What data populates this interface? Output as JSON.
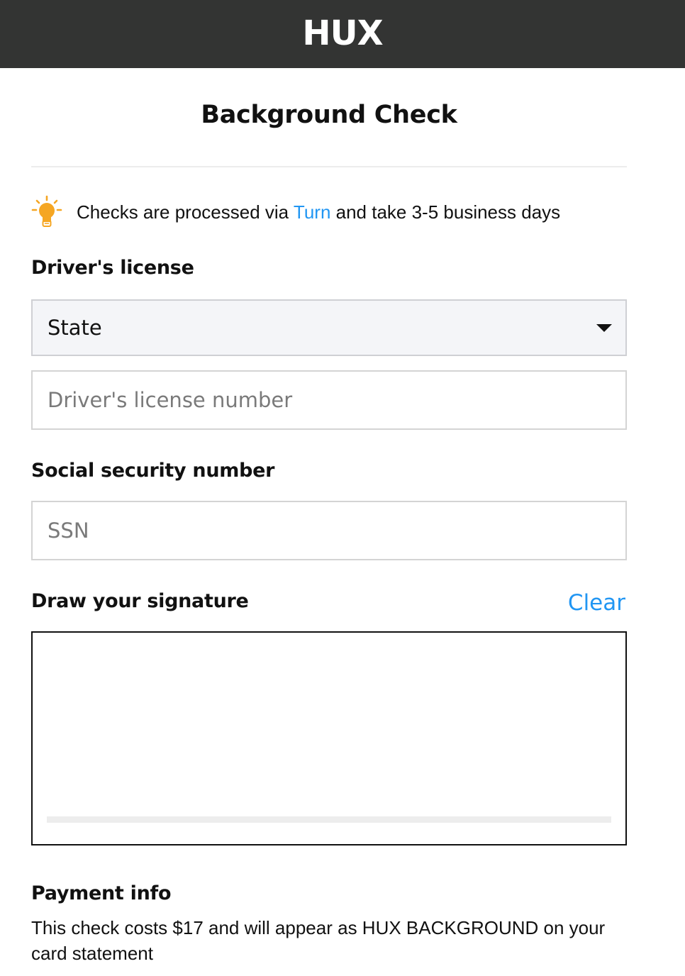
{
  "header": {
    "logo": "HUX"
  },
  "page": {
    "title": "Background Check"
  },
  "info": {
    "icon": "lightbulb-icon",
    "text_before": "Checks are processed via ",
    "link_text": "Turn",
    "text_after": " and take 3-5 business days"
  },
  "drivers_license": {
    "label": "Driver's license",
    "state_select": {
      "value": "State",
      "icon": "caret-down-icon"
    },
    "number_input": {
      "placeholder": "Driver's license number"
    }
  },
  "ssn": {
    "label": "Social security number",
    "input": {
      "placeholder": "SSN"
    }
  },
  "signature": {
    "label": "Draw your signature",
    "clear_label": "Clear"
  },
  "payment": {
    "label": "Payment info",
    "description": "This check costs $17 and will appear as HUX BACKGROUND on your card statement"
  },
  "colors": {
    "header_bg": "#333433",
    "link": "#2196f3",
    "bulb": "#f5a623"
  }
}
